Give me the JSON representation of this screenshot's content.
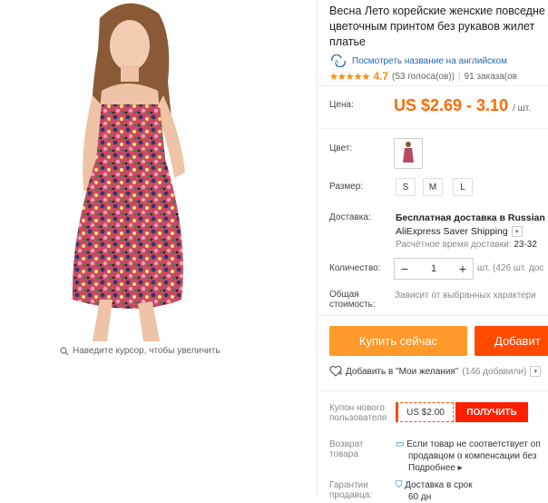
{
  "product": {
    "title_lines": [
      "Весна Лето корейские женские повседне",
      "цветочным принтом без рукавов жилет",
      "платье"
    ],
    "translate_link": "Посмотреть название на английском",
    "rating_stars": "★★★★★",
    "rating_value": "4.7",
    "votes": "(53 голоса(ов))",
    "orders": "91 заказа(ов",
    "zoom_hint": "Наведите курсор, чтобы увеличить"
  },
  "price": {
    "label": "Цена:",
    "value": "US $2.69 - 3.10",
    "unit": "/ шт."
  },
  "color": {
    "label": "Цвет:"
  },
  "size": {
    "label": "Размер:",
    "options": [
      "S",
      "M",
      "L"
    ]
  },
  "shipping": {
    "label": "Доставка:",
    "line1": "Бесплатная доставка в Russian Fe",
    "line2": "AliExpress Saver Shipping",
    "line3_prefix": "Расчётное время доставки:",
    "line3_value": "23-32"
  },
  "quantity": {
    "label": "Количество:",
    "minus": "−",
    "value": "1",
    "plus": "+",
    "info": "шт. (426 шт. дос"
  },
  "total": {
    "label_lines": [
      "Общая",
      "стоимость:"
    ],
    "value": "Зависит от выбранных характери"
  },
  "actions": {
    "buy": "Купить сейчас",
    "cart": "Добавит",
    "wish": "Добавить в \"Мои желания\"",
    "wish_count": "(146 добавили)"
  },
  "coupon": {
    "label_lines": [
      "Купон нового",
      "пользователя"
    ],
    "amount": "US $2.00",
    "get": "ПОЛУЧИТЬ"
  },
  "returns": {
    "label_lines": [
      "Возврат",
      "товара"
    ],
    "lines": [
      "Если товар не соответствует оп",
      "продавцом о компенсации без",
      "Подробнее"
    ]
  },
  "guarantee": {
    "label_lines": [
      "Гарантии",
      "продавца:"
    ],
    "lines": [
      "Доставка в срок",
      "60 дн"
    ]
  },
  "colors": {
    "price": "#ff6a00",
    "buy_button": "#ff9a2a",
    "cart_button": "#ff4a00",
    "coupon_button": "#ff1e00",
    "link": "#1f67b2",
    "stars": "#ff8a00"
  },
  "icons": [
    "translate-icon",
    "search-icon",
    "heart-icon",
    "chevron-down-icon",
    "return-icon",
    "shield-icon"
  ]
}
